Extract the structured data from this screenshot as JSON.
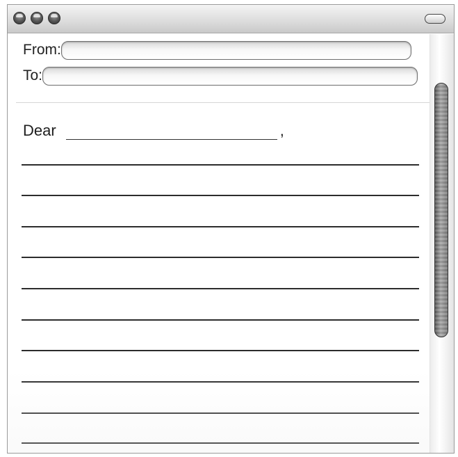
{
  "header": {
    "from_label": "From:",
    "from_value": "",
    "to_label": "To:",
    "to_value": ""
  },
  "letter": {
    "salutation": "Dear",
    "recipient_value": "",
    "comma": ",",
    "line_count": 10
  },
  "scrollbar": {
    "position": 0.0
  },
  "icons": [
    "close-icon",
    "minimize-icon",
    "zoom-icon",
    "toolbar-toggle-icon"
  ]
}
